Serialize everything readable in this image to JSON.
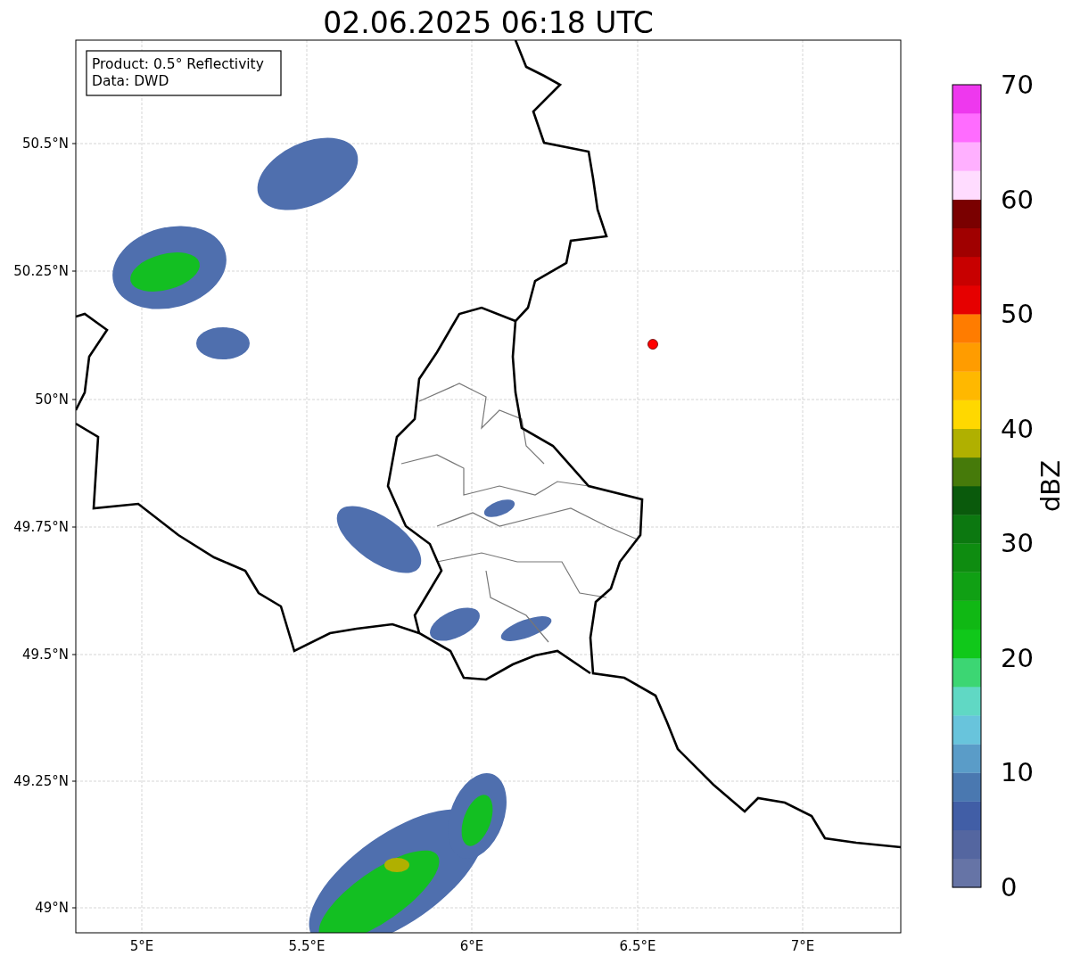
{
  "title": "02.06.2025 06:18 UTC",
  "map": {
    "info_box": [
      "Product: 0.5° Reflectivity",
      "Data: DWD"
    ],
    "lat_labels": [
      "50.5°N",
      "50.25°N",
      "50°N",
      "49.75°N",
      "49.5°N",
      "49.25°N",
      "49°N"
    ],
    "lon_labels": [
      "5°E",
      "5.5°E",
      "6°E",
      "6.5°E",
      "7°E"
    ]
  },
  "colorbar": {
    "label": "dBZ",
    "ticks": [
      "70",
      "60",
      "50",
      "40",
      "30",
      "20",
      "10",
      "0"
    ],
    "bands": [
      {
        "color": "#6674a6"
      },
      {
        "color": "#5466a0"
      },
      {
        "color": "#415ea6"
      },
      {
        "color": "#4a78b0"
      },
      {
        "color": "#5a9cc8"
      },
      {
        "color": "#68c4dc"
      },
      {
        "color": "#60d8c4"
      },
      {
        "color": "#3cd673"
      },
      {
        "color": "#10c81a"
      },
      {
        "color": "#10b814"
      },
      {
        "color": "#10a014"
      },
      {
        "color": "#0e8c10"
      },
      {
        "color": "#0c7810"
      },
      {
        "color": "#0a5a0c"
      },
      {
        "color": "#467a0a"
      },
      {
        "color": "#b0b000"
      },
      {
        "color": "#ffd800"
      },
      {
        "color": "#ffb800"
      },
      {
        "color": "#ff9c00"
      },
      {
        "color": "#ff7c00"
      },
      {
        "color": "#e60000"
      },
      {
        "color": "#c80000"
      },
      {
        "color": "#a00000"
      },
      {
        "color": "#7a0000"
      },
      {
        "color": "#ffdcff"
      },
      {
        "color": "#ffb0ff"
      },
      {
        "color": "#ff6cff"
      },
      {
        "color": "#ee38ee"
      }
    ]
  }
}
